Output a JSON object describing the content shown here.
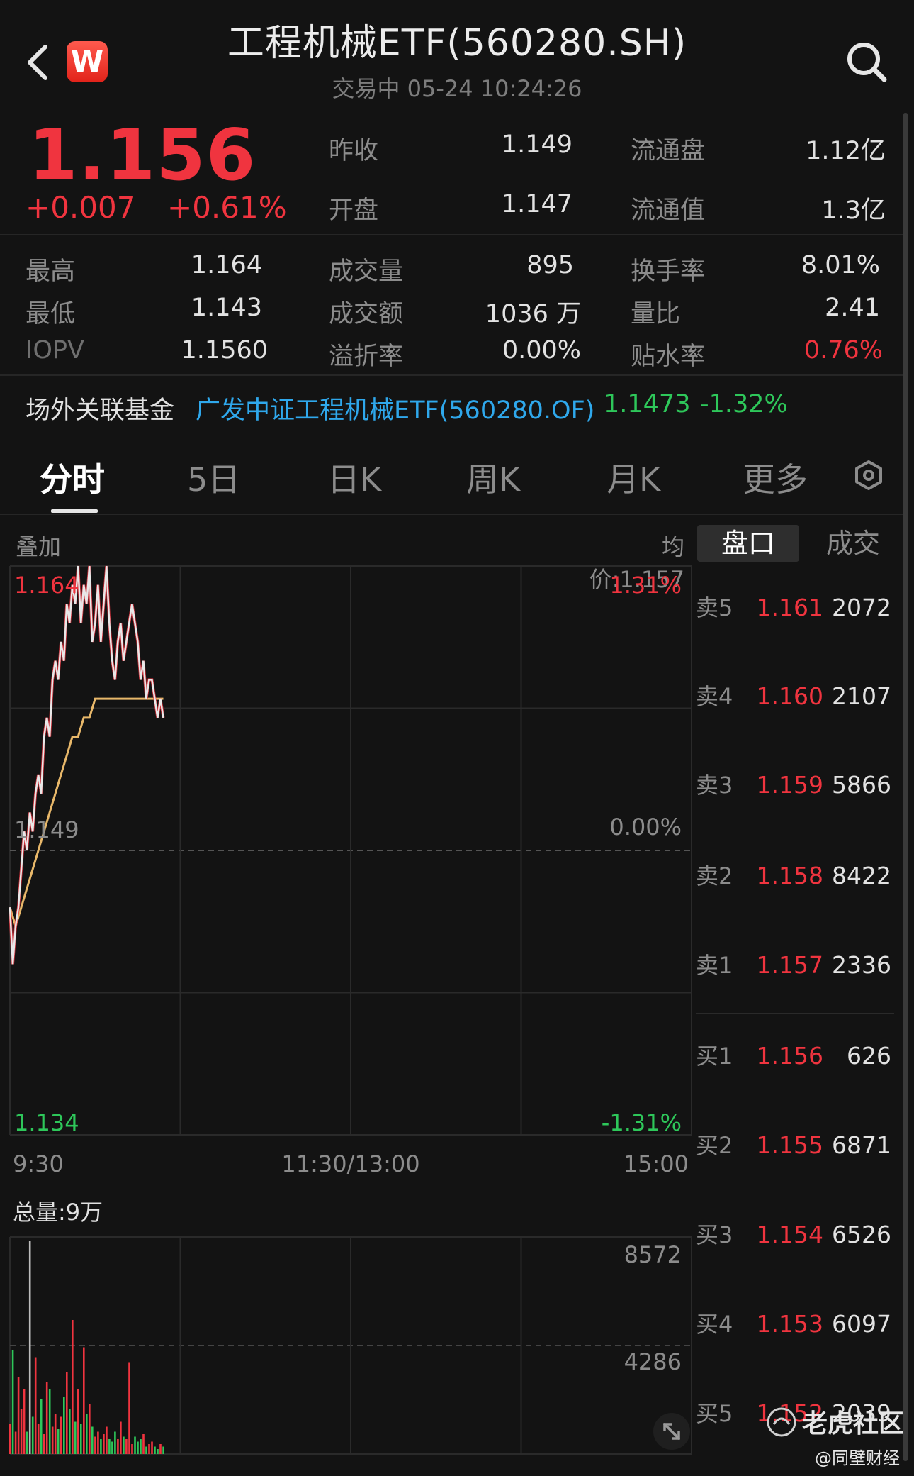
{
  "header": {
    "title": "工程机械ETF(560280.SH)",
    "status": "交易中 05-24 10:24:26",
    "logo_letter": "W"
  },
  "quote": {
    "price": "1.156",
    "change": "+0.007",
    "change_pct": "+0.61%",
    "stats": {
      "prev_close_label": "昨收",
      "prev_close": "1.149",
      "float_shares_label": "流通盘",
      "float_shares": "1.12亿",
      "open_label": "开盘",
      "open": "1.147",
      "float_value_label": "流通值",
      "float_value": "1.3亿",
      "high_label": "最高",
      "high": "1.164",
      "volume_label": "成交量",
      "volume": "895",
      "turnover_rate_label": "换手率",
      "turnover_rate": "8.01%",
      "low_label": "最低",
      "low": "1.143",
      "amount_label": "成交额",
      "amount": "1036 万",
      "volume_ratio_label": "量比",
      "volume_ratio": "2.41",
      "iopv_label": "IOPV",
      "iopv": "1.1560",
      "premium_label": "溢折率",
      "premium": "0.00%",
      "discount_label": "贴水率",
      "discount": "0.76%"
    }
  },
  "related_fund": {
    "label": "场外关联基金",
    "name": "广发中证工程机械ETF(560280.OF)",
    "price": "1.1473",
    "change_pct": "-1.32%"
  },
  "tabs": [
    "分时",
    "5日",
    "日K",
    "周K",
    "月K",
    "更多"
  ],
  "chart": {
    "overlay_label": "叠加",
    "avg_price_label": "均价:1.157",
    "total_volume_label": "总量:9万"
  },
  "orderbook": {
    "tabs": [
      "盘口",
      "成交"
    ],
    "asks": [
      {
        "side": "卖5",
        "price": "1.161",
        "qty": "2072"
      },
      {
        "side": "卖4",
        "price": "1.160",
        "qty": "2107"
      },
      {
        "side": "卖3",
        "price": "1.159",
        "qty": "5866"
      },
      {
        "side": "卖2",
        "price": "1.158",
        "qty": "8422"
      },
      {
        "side": "卖1",
        "price": "1.157",
        "qty": "2336"
      }
    ],
    "bids": [
      {
        "side": "买1",
        "price": "1.156",
        "qty": "626"
      },
      {
        "side": "买2",
        "price": "1.155",
        "qty": "6871"
      },
      {
        "side": "买3",
        "price": "1.154",
        "qty": "6526"
      },
      {
        "side": "买4",
        "price": "1.153",
        "qty": "6097"
      },
      {
        "side": "买5",
        "price": "1.152",
        "qty": "2039"
      }
    ]
  },
  "watermark": {
    "brand": "老虎社区",
    "sub": "@同壁财经"
  },
  "colors": {
    "up": "#f0343f",
    "down": "#2ec75a",
    "link": "#2fa8ec",
    "avg_line": "#e8b86a",
    "price_line": "#e8e8e8"
  },
  "chart_data": {
    "type": "line",
    "x_ticks": [
      "9:30",
      "11:30/13:00",
      "15:00"
    ],
    "y_ticks_left": [
      "1.164",
      "1.149",
      "1.134"
    ],
    "y_ticks_right": [
      "1.31%",
      "0.00%",
      "-1.31%"
    ],
    "ylim": [
      1.134,
      1.164
    ],
    "x_minutes_total": 240,
    "series": [
      {
        "name": "",
        "x": [
          0,
          1,
          2,
          3,
          4,
          5,
          6,
          7,
          8,
          9,
          10,
          11,
          12,
          13,
          14,
          15,
          16,
          17,
          18,
          19,
          20,
          21,
          22,
          23,
          24,
          25,
          26,
          27,
          28,
          29,
          30,
          31,
          32,
          33,
          34,
          35,
          36,
          37,
          38,
          39,
          40,
          41,
          42,
          43,
          44,
          45,
          46,
          47,
          48,
          49,
          50,
          51,
          52,
          53,
          54
        ],
        "values": [
          1.146,
          1.143,
          1.145,
          1.146,
          1.148,
          1.15,
          1.149,
          1.151,
          1.15,
          1.152,
          1.153,
          1.152,
          1.155,
          1.156,
          1.155,
          1.158,
          1.159,
          1.158,
          1.16,
          1.159,
          1.162,
          1.161,
          1.163,
          1.162,
          1.164,
          1.161,
          1.163,
          1.162,
          1.164,
          1.16,
          1.161,
          1.163,
          1.16,
          1.162,
          1.164,
          1.161,
          1.159,
          1.158,
          1.16,
          1.161,
          1.159,
          1.16,
          1.161,
          1.162,
          1.161,
          1.16,
          1.158,
          1.159,
          1.157,
          1.158,
          1.158,
          1.157,
          1.156,
          1.157,
          1.156
        ]
      },
      {
        "name": "",
        "x": [
          0,
          2,
          4,
          6,
          8,
          10,
          12,
          14,
          16,
          18,
          20,
          22,
          24,
          26,
          28,
          30,
          32,
          34,
          36,
          38,
          40,
          42,
          44,
          46,
          48,
          50,
          52,
          54
        ],
        "values": [
          1.146,
          1.145,
          1.146,
          1.147,
          1.148,
          1.149,
          1.15,
          1.151,
          1.152,
          1.153,
          1.154,
          1.155,
          1.155,
          1.156,
          1.156,
          1.157,
          1.157,
          1.157,
          1.157,
          1.157,
          1.157,
          1.157,
          1.157,
          1.157,
          1.157,
          1.157,
          1.157,
          1.157
        ]
      }
    ],
    "volume_ticks": [
      "8572",
      "4286"
    ],
    "volume_max": 8572,
    "volumes": [
      1200,
      4200,
      900,
      3100,
      1800,
      2600,
      900,
      8572,
      1500,
      3900,
      1200,
      2200,
      800,
      2900,
      2600,
      1100,
      1600,
      1000,
      1500,
      2300,
      3300,
      1800,
      5400,
      1300,
      2600,
      1200,
      4300,
      1600,
      2000,
      1100,
      700,
      900,
      600,
      800,
      1100,
      600,
      500,
      900,
      600,
      1300,
      700,
      600,
      3700,
      400,
      700,
      500,
      600,
      800,
      300,
      400,
      500,
      300,
      200,
      400,
      300
    ]
  }
}
